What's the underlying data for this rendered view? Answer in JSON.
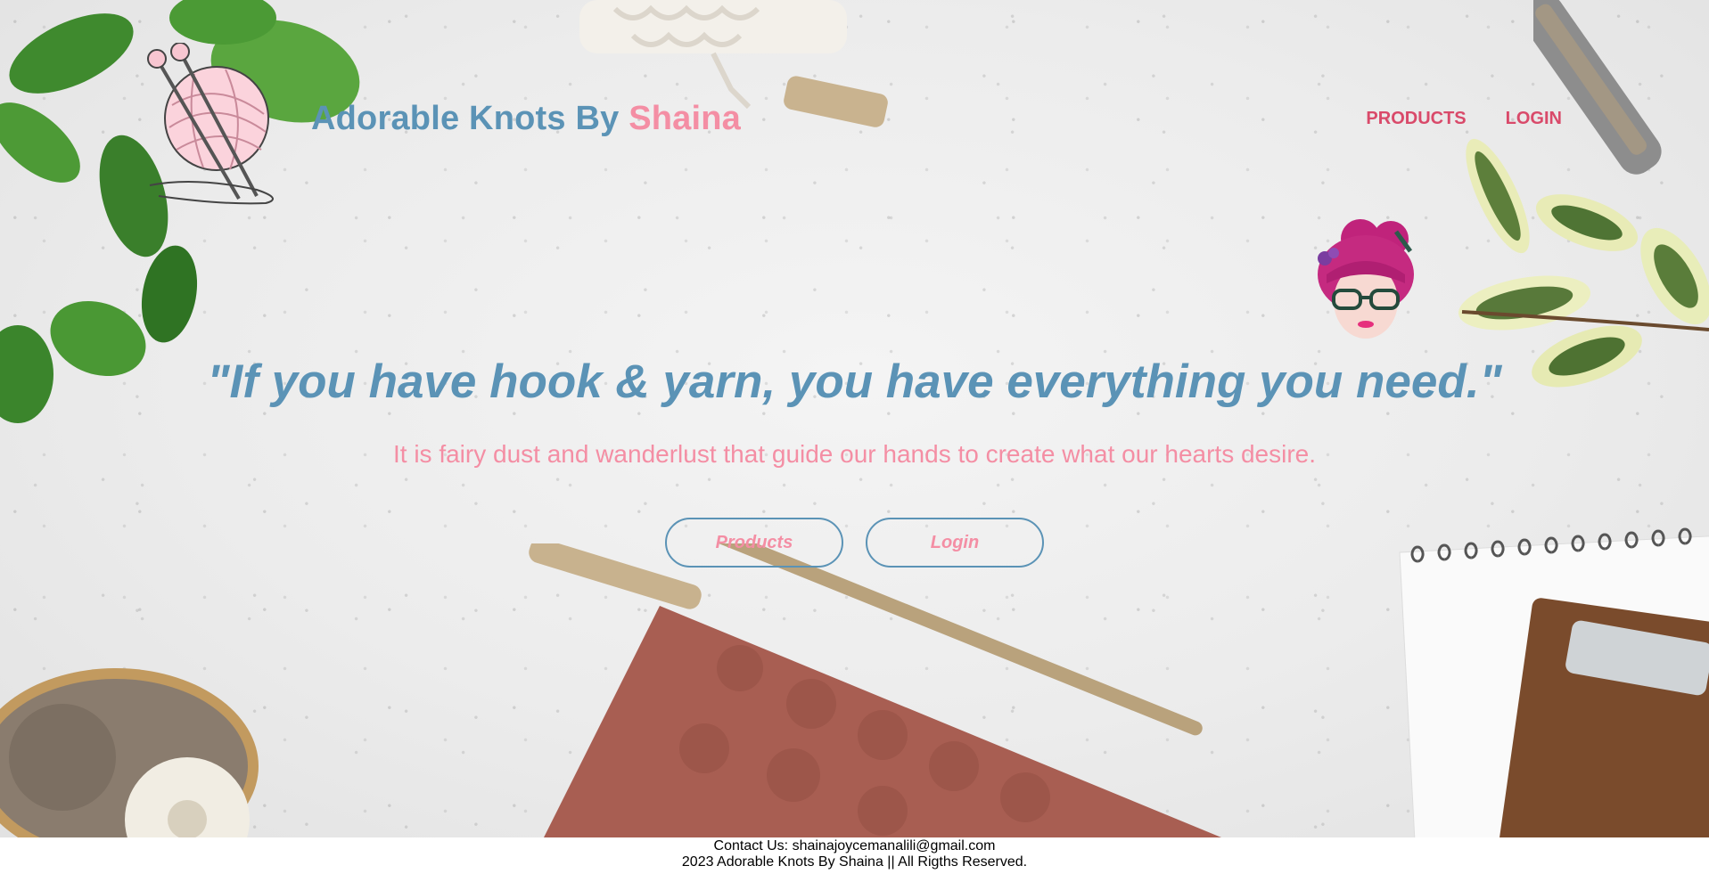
{
  "brand": {
    "name_main": "Adorable Knots By",
    "name_accent": "Shaina",
    "logo_icon": "yarn-ball-with-needles-icon"
  },
  "nav": {
    "products_label": "PRODUCTS",
    "login_label": "LOGIN"
  },
  "hero": {
    "avatar_icon": "knitter-girl-avatar-icon",
    "quote": "\"If you have hook & yarn, you have everything you need.\"",
    "tagline": "It is fairy dust and wanderlust that guide our hands to create what our hearts desire.",
    "buttons": {
      "products_label": "Products",
      "login_label": "Login"
    }
  },
  "footer": {
    "contact": "Contact Us: shainajoycemanalili@gmail.com",
    "copyright": "2023 Adorable Knots By Shaina || All Rigths Reserved."
  },
  "colors": {
    "brand_blue": "#5b93b6",
    "brand_pink": "#f48ea4",
    "nav_pink": "#d94a6a"
  }
}
